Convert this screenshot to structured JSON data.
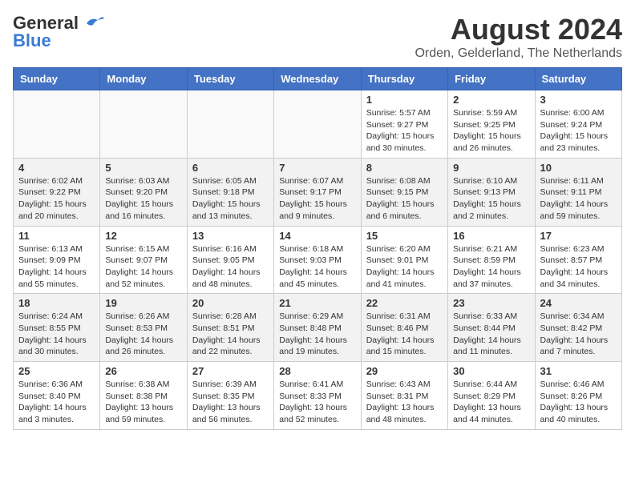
{
  "header": {
    "logo_general": "General",
    "logo_blue": "Blue",
    "month_year": "August 2024",
    "location": "Orden, Gelderland, The Netherlands"
  },
  "days_of_week": [
    "Sunday",
    "Monday",
    "Tuesday",
    "Wednesday",
    "Thursday",
    "Friday",
    "Saturday"
  ],
  "weeks": [
    [
      {
        "day": "",
        "info": ""
      },
      {
        "day": "",
        "info": ""
      },
      {
        "day": "",
        "info": ""
      },
      {
        "day": "",
        "info": ""
      },
      {
        "day": "1",
        "info": "Sunrise: 5:57 AM\nSunset: 9:27 PM\nDaylight: 15 hours and 30 minutes."
      },
      {
        "day": "2",
        "info": "Sunrise: 5:59 AM\nSunset: 9:25 PM\nDaylight: 15 hours and 26 minutes."
      },
      {
        "day": "3",
        "info": "Sunrise: 6:00 AM\nSunset: 9:24 PM\nDaylight: 15 hours and 23 minutes."
      }
    ],
    [
      {
        "day": "4",
        "info": "Sunrise: 6:02 AM\nSunset: 9:22 PM\nDaylight: 15 hours and 20 minutes."
      },
      {
        "day": "5",
        "info": "Sunrise: 6:03 AM\nSunset: 9:20 PM\nDaylight: 15 hours and 16 minutes."
      },
      {
        "day": "6",
        "info": "Sunrise: 6:05 AM\nSunset: 9:18 PM\nDaylight: 15 hours and 13 minutes."
      },
      {
        "day": "7",
        "info": "Sunrise: 6:07 AM\nSunset: 9:17 PM\nDaylight: 15 hours and 9 minutes."
      },
      {
        "day": "8",
        "info": "Sunrise: 6:08 AM\nSunset: 9:15 PM\nDaylight: 15 hours and 6 minutes."
      },
      {
        "day": "9",
        "info": "Sunrise: 6:10 AM\nSunset: 9:13 PM\nDaylight: 15 hours and 2 minutes."
      },
      {
        "day": "10",
        "info": "Sunrise: 6:11 AM\nSunset: 9:11 PM\nDaylight: 14 hours and 59 minutes."
      }
    ],
    [
      {
        "day": "11",
        "info": "Sunrise: 6:13 AM\nSunset: 9:09 PM\nDaylight: 14 hours and 55 minutes."
      },
      {
        "day": "12",
        "info": "Sunrise: 6:15 AM\nSunset: 9:07 PM\nDaylight: 14 hours and 52 minutes."
      },
      {
        "day": "13",
        "info": "Sunrise: 6:16 AM\nSunset: 9:05 PM\nDaylight: 14 hours and 48 minutes."
      },
      {
        "day": "14",
        "info": "Sunrise: 6:18 AM\nSunset: 9:03 PM\nDaylight: 14 hours and 45 minutes."
      },
      {
        "day": "15",
        "info": "Sunrise: 6:20 AM\nSunset: 9:01 PM\nDaylight: 14 hours and 41 minutes."
      },
      {
        "day": "16",
        "info": "Sunrise: 6:21 AM\nSunset: 8:59 PM\nDaylight: 14 hours and 37 minutes."
      },
      {
        "day": "17",
        "info": "Sunrise: 6:23 AM\nSunset: 8:57 PM\nDaylight: 14 hours and 34 minutes."
      }
    ],
    [
      {
        "day": "18",
        "info": "Sunrise: 6:24 AM\nSunset: 8:55 PM\nDaylight: 14 hours and 30 minutes."
      },
      {
        "day": "19",
        "info": "Sunrise: 6:26 AM\nSunset: 8:53 PM\nDaylight: 14 hours and 26 minutes."
      },
      {
        "day": "20",
        "info": "Sunrise: 6:28 AM\nSunset: 8:51 PM\nDaylight: 14 hours and 22 minutes."
      },
      {
        "day": "21",
        "info": "Sunrise: 6:29 AM\nSunset: 8:48 PM\nDaylight: 14 hours and 19 minutes."
      },
      {
        "day": "22",
        "info": "Sunrise: 6:31 AM\nSunset: 8:46 PM\nDaylight: 14 hours and 15 minutes."
      },
      {
        "day": "23",
        "info": "Sunrise: 6:33 AM\nSunset: 8:44 PM\nDaylight: 14 hours and 11 minutes."
      },
      {
        "day": "24",
        "info": "Sunrise: 6:34 AM\nSunset: 8:42 PM\nDaylight: 14 hours and 7 minutes."
      }
    ],
    [
      {
        "day": "25",
        "info": "Sunrise: 6:36 AM\nSunset: 8:40 PM\nDaylight: 14 hours and 3 minutes."
      },
      {
        "day": "26",
        "info": "Sunrise: 6:38 AM\nSunset: 8:38 PM\nDaylight: 13 hours and 59 minutes."
      },
      {
        "day": "27",
        "info": "Sunrise: 6:39 AM\nSunset: 8:35 PM\nDaylight: 13 hours and 56 minutes."
      },
      {
        "day": "28",
        "info": "Sunrise: 6:41 AM\nSunset: 8:33 PM\nDaylight: 13 hours and 52 minutes."
      },
      {
        "day": "29",
        "info": "Sunrise: 6:43 AM\nSunset: 8:31 PM\nDaylight: 13 hours and 48 minutes."
      },
      {
        "day": "30",
        "info": "Sunrise: 6:44 AM\nSunset: 8:29 PM\nDaylight: 13 hours and 44 minutes."
      },
      {
        "day": "31",
        "info": "Sunrise: 6:46 AM\nSunset: 8:26 PM\nDaylight: 13 hours and 40 minutes."
      }
    ]
  ]
}
